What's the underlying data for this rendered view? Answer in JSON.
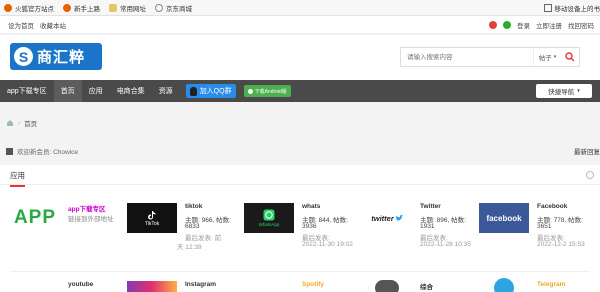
{
  "bookmarks": {
    "items": [
      {
        "label": "火狐官方站点",
        "color": "#e66000"
      },
      {
        "label": "新手上路",
        "color": "#e66000"
      },
      {
        "label": "常用网址",
        "color": "#c9a23a"
      },
      {
        "label": "京东商城",
        "color": "#999999"
      }
    ],
    "right_label": "移动设备上的书"
  },
  "topbar": {
    "left": [
      "设为首页",
      "收藏本站"
    ],
    "right": [
      "登录",
      "立即注册",
      "找回密码"
    ],
    "menu": "导航"
  },
  "header": {
    "logo_letter": "S",
    "logo_text": "商汇粹",
    "search_placeholder": "请输入搜索内容",
    "search_select": "帖子"
  },
  "nav": {
    "items": [
      "app下载专区",
      "首页",
      "应用",
      "电商合集",
      "资源"
    ],
    "active": 1,
    "qq_label": "加入QQ群",
    "android_label": "下载Android版",
    "quick_label": "快捷导航"
  },
  "breadcrumb": {
    "label": "首页"
  },
  "notice": {
    "text": "欢迎新会员: Chowice",
    "latest": "最新回复"
  },
  "panel": {
    "title": "应用",
    "forums": [
      {
        "name": "app下载专区",
        "desc": "链接到外部地址",
        "thumb": "APP",
        "thumb_bg": "#ffffff",
        "thumb_color": "#27a844"
      },
      {
        "name": "tiktok",
        "stats": "主题: 966, 帖数:",
        "stats2": "6833",
        "last_label": "最后发表: 前",
        "last": "天 12:39",
        "thumb": "TikTok",
        "thumb_bg": "#111111",
        "thumb_color": "#ffffff"
      },
      {
        "name": "whats",
        "stats": "主题: 844, 帖数:",
        "stats2": "3936",
        "last_label": "最后发表:",
        "last": "2022-11-30 19:02",
        "thumb": "WhatsApp",
        "thumb_bg": "#1a1a1a",
        "thumb_color": "#25d366"
      },
      {
        "name": "Twitter",
        "stats": "主题: 896, 帖数:",
        "stats2": "1931",
        "last_label": "最后发表:",
        "last": "2022-11-28 10:35",
        "thumb": "twitter",
        "thumb_bg": "#ffffff",
        "thumb_color": "#222222"
      },
      {
        "name": "Facebook",
        "stats": "主题: 778, 帖数:",
        "stats2": "3651",
        "last_label": "最后发表:",
        "last": "2022-12-2 15:53",
        "thumb": "facebook",
        "thumb_bg": "#3b5998",
        "thumb_color": "#ffffff"
      }
    ],
    "row2": [
      {
        "name": "youtube"
      },
      {
        "name": "Instagram"
      },
      {
        "name": "Spotify"
      },
      {
        "name": "综合"
      },
      {
        "name": "Telegram"
      }
    ]
  }
}
